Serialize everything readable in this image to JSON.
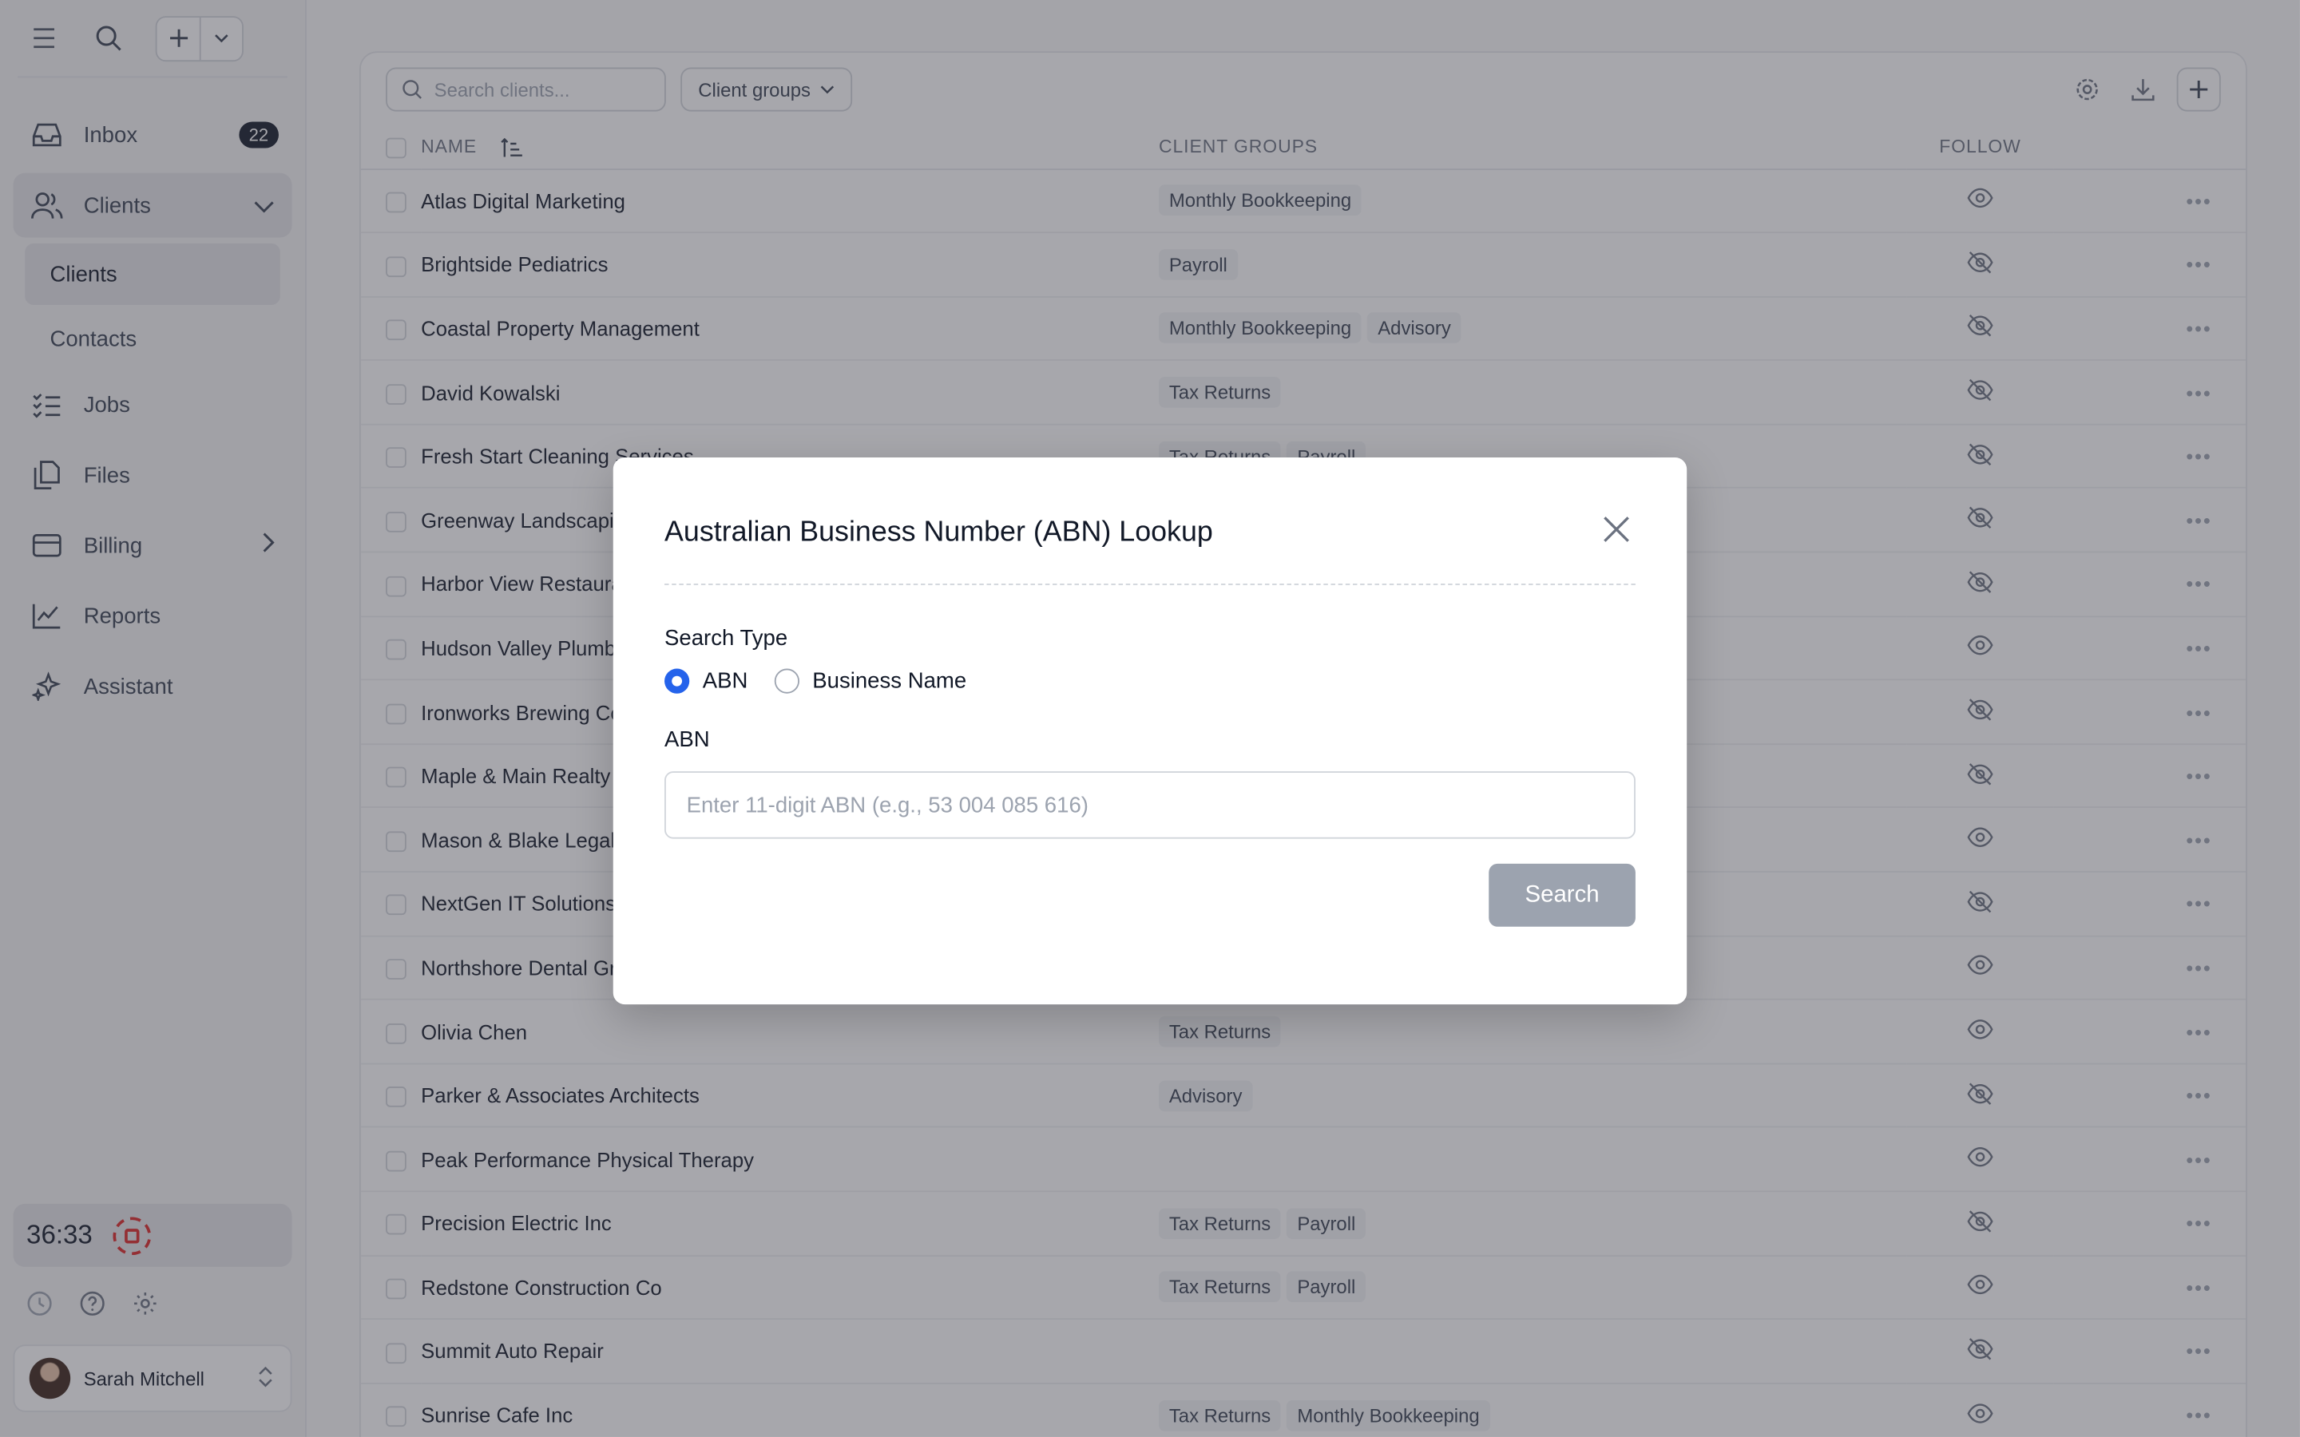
{
  "sidebar": {
    "nav": [
      {
        "label": "Inbox",
        "badge": "22"
      },
      {
        "label": "Clients"
      },
      {
        "label": "Jobs"
      },
      {
        "label": "Files"
      },
      {
        "label": "Billing"
      },
      {
        "label": "Reports"
      },
      {
        "label": "Assistant"
      }
    ],
    "sub": [
      "Clients",
      "Contacts"
    ],
    "timer": "36:33",
    "user": "Sarah Mitchell"
  },
  "toolbar": {
    "search_placeholder": "Search clients...",
    "groups_label": "Client groups"
  },
  "table": {
    "headers": {
      "name": "NAME",
      "groups": "CLIENT GROUPS",
      "follow": "FOLLOW"
    },
    "rows": [
      {
        "name": "Atlas Digital Marketing",
        "groups": [
          "Monthly Bookkeeping"
        ],
        "follow": true
      },
      {
        "name": "Brightside Pediatrics",
        "groups": [
          "Payroll"
        ],
        "follow": false
      },
      {
        "name": "Coastal Property Management",
        "groups": [
          "Monthly Bookkeeping",
          "Advisory"
        ],
        "follow": false
      },
      {
        "name": "David Kowalski",
        "groups": [
          "Tax Returns"
        ],
        "follow": false
      },
      {
        "name": "Fresh Start Cleaning Services",
        "groups": [
          "Tax Returns",
          "Payroll"
        ],
        "follow": false
      },
      {
        "name": "Greenway Landscaping",
        "groups": [],
        "follow": false
      },
      {
        "name": "Harbor View Restaurant",
        "groups": [],
        "follow": false
      },
      {
        "name": "Hudson Valley Plumbing",
        "groups": [],
        "follow": true
      },
      {
        "name": "Ironworks Brewing Co",
        "groups": [],
        "follow": false
      },
      {
        "name": "Maple & Main Realty",
        "groups": [],
        "follow": false
      },
      {
        "name": "Mason & Blake Legal",
        "groups": [],
        "follow": true
      },
      {
        "name": "NextGen IT Solutions",
        "groups": [],
        "follow": false
      },
      {
        "name": "Northshore Dental Group",
        "groups": [],
        "follow": true
      },
      {
        "name": "Olivia Chen",
        "groups": [
          "Tax Returns"
        ],
        "follow": true
      },
      {
        "name": "Parker & Associates Architects",
        "groups": [
          "Advisory"
        ],
        "follow": false
      },
      {
        "name": "Peak Performance Physical Therapy",
        "groups": [],
        "follow": true
      },
      {
        "name": "Precision Electric Inc",
        "groups": [
          "Tax Returns",
          "Payroll"
        ],
        "follow": false
      },
      {
        "name": "Redstone Construction Co",
        "groups": [
          "Tax Returns",
          "Payroll"
        ],
        "follow": true
      },
      {
        "name": "Summit Auto Repair",
        "groups": [],
        "follow": false
      },
      {
        "name": "Sunrise Cafe Inc",
        "groups": [
          "Tax Returns",
          "Monthly Bookkeeping"
        ],
        "follow": true
      }
    ]
  },
  "modal": {
    "title": "Australian Business Number (ABN) Lookup",
    "search_type_label": "Search Type",
    "options": [
      "ABN",
      "Business Name"
    ],
    "selected": "ABN",
    "field_label": "ABN",
    "placeholder": "Enter 11-digit ABN (e.g., 53 004 085 616)",
    "search_button": "Search"
  }
}
